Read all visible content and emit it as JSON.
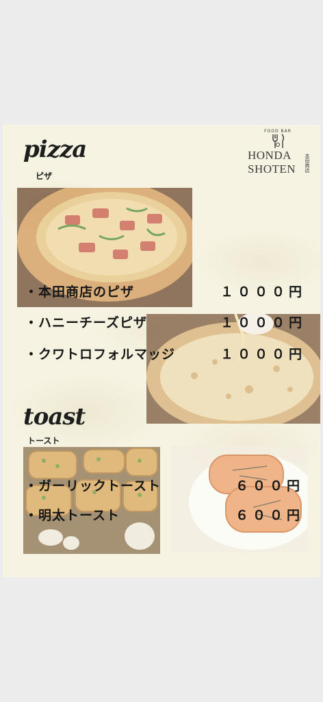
{
  "brand": {
    "small_caps": "FOOD BAR",
    "name_line1": "HONDA",
    "name_line2": "SHOTEN",
    "vertical_jp": "本田商店"
  },
  "sections": [
    {
      "title": "pizza",
      "subtitle": "ピザ",
      "items": [
        {
          "name": "・本田商店のピザ",
          "price": "１０００円"
        },
        {
          "name": "・ハニーチーズピザ",
          "price": "１０００円"
        },
        {
          "name": "・クワトロフォルマッジ",
          "price": "１０００円"
        }
      ]
    },
    {
      "title": "toast",
      "subtitle": "トースト",
      "items": [
        {
          "name": "・ガーリックトースト",
          "price": "６００円"
        },
        {
          "name": "・明太トースト",
          "price": "６００円"
        }
      ]
    }
  ],
  "colors": {
    "card_background": "#f6f3e2",
    "page_background": "#ececec",
    "text": "#161616"
  },
  "images": [
    "pizza-photo",
    "honey-cheese-pizza-photo",
    "garlic-toast-photo",
    "mentai-toast-photo"
  ]
}
